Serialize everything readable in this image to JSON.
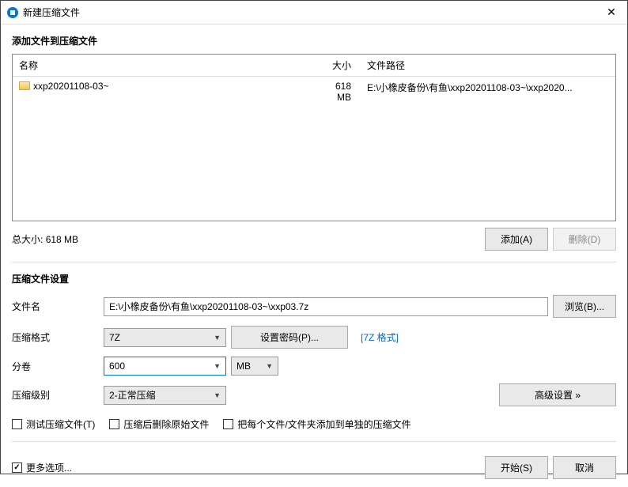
{
  "window": {
    "title": "新建压缩文件"
  },
  "add_section_title": "添加文件到压缩文件",
  "columns": {
    "name": "名称",
    "size": "大小",
    "path": "文件路径"
  },
  "rows": [
    {
      "name": "xxp20201108-03~",
      "size": "618 MB",
      "path": "E:\\小橡皮备份\\有鱼\\xxp20201108-03~\\xxp2020..."
    }
  ],
  "total_label": "总大小:",
  "total_value": "618 MB",
  "buttons": {
    "add": "添加(A)",
    "remove": "删除(D)",
    "browse": "浏览(B)...",
    "set_password": "设置密码(P)...",
    "advanced": "高级设置 »",
    "start": "开始(S)",
    "cancel": "取消"
  },
  "settings_title": "压缩文件设置",
  "labels": {
    "filename": "文件名",
    "format": "压缩格式",
    "split": "分卷",
    "level": "压缩级别"
  },
  "filename_value": "E:\\小橡皮备份\\有鱼\\xxp20201108-03~\\xxp03.7z",
  "format_value": "7Z",
  "format_link": "[7Z 格式]",
  "split_value": "600",
  "split_unit": "MB",
  "level_value": "2-正常压缩",
  "checks": {
    "test": "测试压缩文件(T)",
    "delete_after": "压缩后删除原始文件",
    "each_separate": "把每个文件/文件夹添加到单独的压缩文件"
  },
  "more_options": "更多选项..."
}
